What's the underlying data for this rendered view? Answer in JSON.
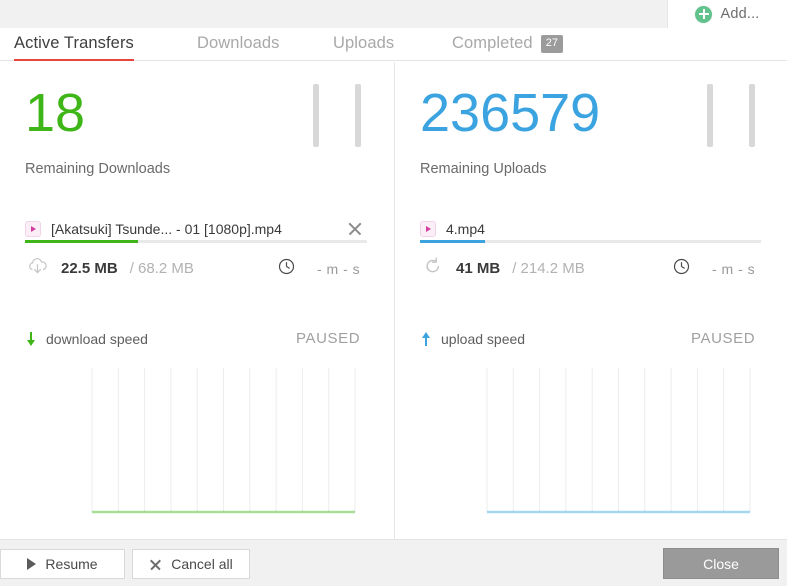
{
  "header": {
    "add_button_label": "Add...",
    "add_icon": "plus-circle-icon"
  },
  "tabs": [
    {
      "label": "Active Transfers",
      "active": true,
      "badge": null
    },
    {
      "label": "Downloads",
      "active": false,
      "badge": null
    },
    {
      "label": "Uploads",
      "active": false,
      "badge": null
    },
    {
      "label": "Completed",
      "active": false,
      "badge": "27"
    }
  ],
  "accent": {
    "active_tab_underline": "#e8453c",
    "download_green": "#3fb618",
    "upload_blue": "#3ba3e0",
    "add_green": "#61c28c"
  },
  "download_panel": {
    "count": "18",
    "count_label": "Remaining Downloads",
    "pause_icon": "pause-icon",
    "transfer": {
      "file_icon": "video-file-icon",
      "file_name": "[Akatsuki] Tsunde... - 01 [1080p].mp4",
      "remove_icon": "close-icon",
      "progress_percent": 33,
      "progress_color": "#3fb618",
      "transfer_icon": "cloud-download-icon",
      "size_done": "22.5 MB",
      "size_total": "/ 68.2 MB",
      "eta_icon": "clock-icon",
      "eta": "- m - s"
    },
    "speed": {
      "direction_icon": "arrow-down-icon",
      "label": "download speed",
      "status": "PAUSED"
    },
    "chart_data": {
      "type": "line",
      "title": "download speed",
      "series": [
        {
          "name": "download speed",
          "values": [
            0,
            0,
            0,
            0,
            0,
            0,
            0,
            0,
            0,
            0,
            0
          ]
        }
      ],
      "x": [
        0,
        1,
        2,
        3,
        4,
        5,
        6,
        7,
        8,
        9,
        10
      ],
      "line_color": "#3fb618",
      "fill_color": "#cfe8c1",
      "gridlines": 10,
      "grid": true,
      "xlabel": "",
      "ylabel": "",
      "ylim": [
        0,
        1
      ],
      "legend": "none"
    }
  },
  "upload_panel": {
    "count": "236579",
    "count_label": "Remaining Uploads",
    "pause_icon": "pause-icon",
    "transfer": {
      "file_icon": "video-file-icon",
      "file_name": "4.mp4",
      "remove_icon": null,
      "progress_percent": 19,
      "progress_color": "#3ba3e0",
      "transfer_icon": "sync-upload-icon",
      "size_done": "41 MB",
      "size_total": "/ 214.2 MB",
      "eta_icon": "clock-icon",
      "eta": "- m - s"
    },
    "speed": {
      "direction_icon": "arrow-up-icon",
      "label": "upload speed",
      "status": "PAUSED"
    },
    "chart_data": {
      "type": "line",
      "title": "upload speed",
      "series": [
        {
          "name": "upload speed",
          "values": [
            0,
            0,
            0,
            0,
            0,
            0,
            0,
            0,
            0,
            0,
            0
          ]
        }
      ],
      "x": [
        0,
        1,
        2,
        3,
        4,
        5,
        6,
        7,
        8,
        9,
        10
      ],
      "line_color": "#3ba3e0",
      "fill_color": "#c6e4f4",
      "gridlines": 10,
      "grid": true,
      "xlabel": "",
      "ylabel": "",
      "ylim": [
        0,
        1
      ],
      "legend": "none"
    }
  },
  "footer": {
    "resume_label": "Resume",
    "resume_icon": "play-icon",
    "cancel_label": "Cancel all",
    "cancel_icon": "close-icon",
    "close_label": "Close"
  }
}
